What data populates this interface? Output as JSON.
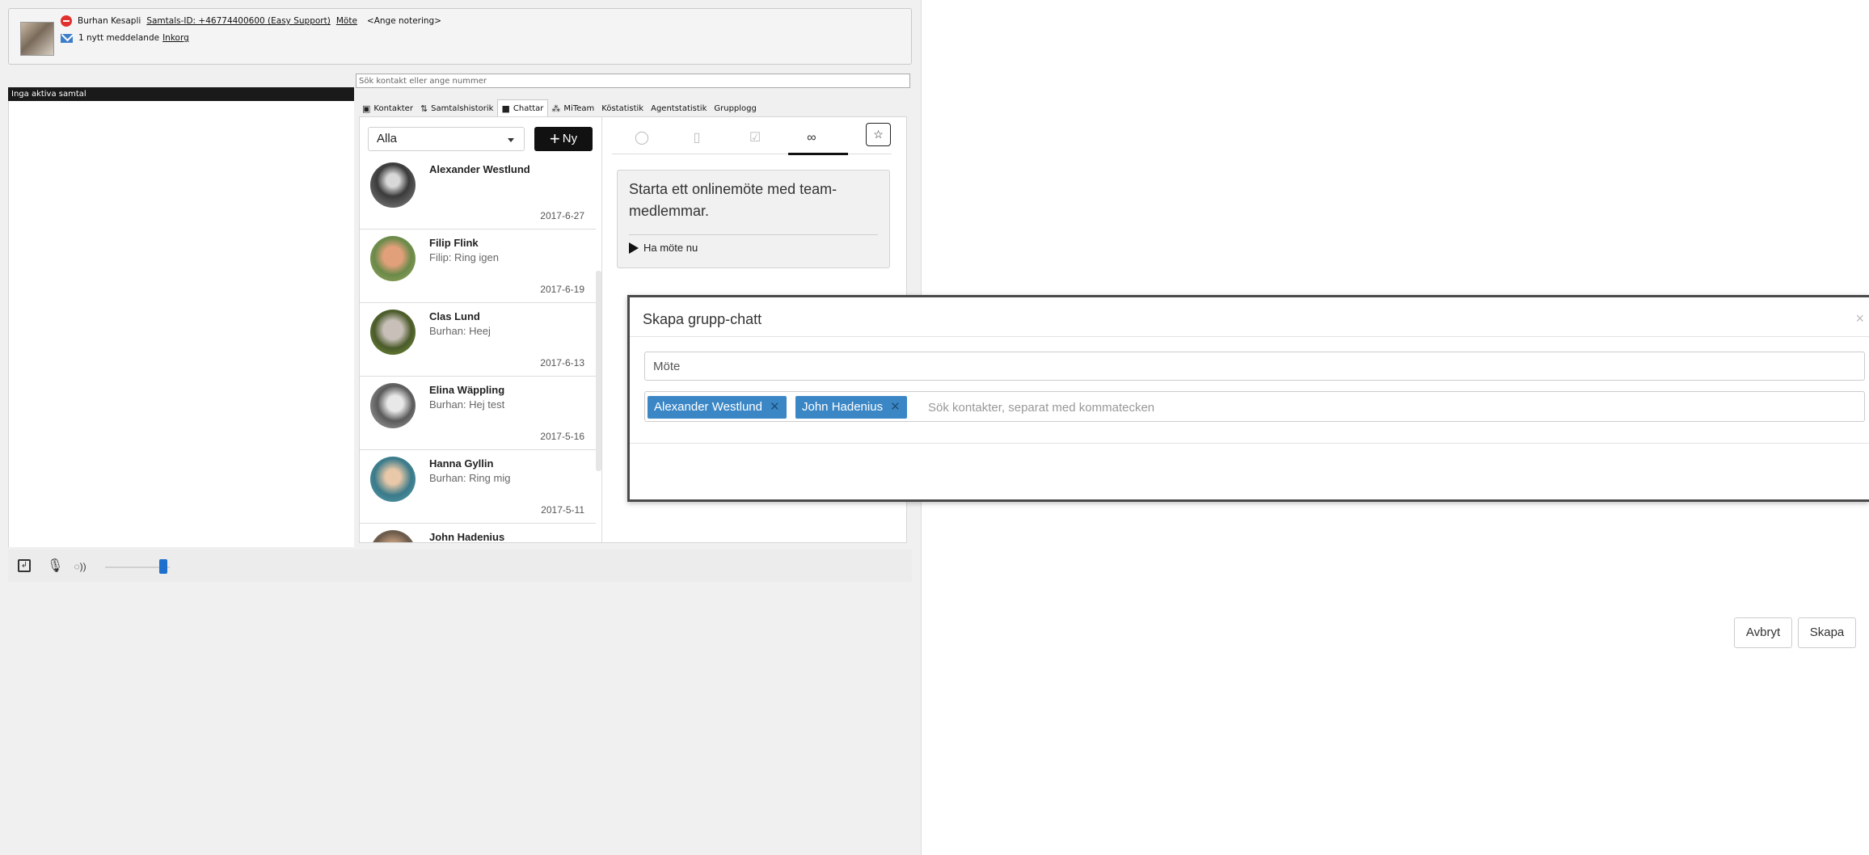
{
  "status": {
    "caller_name": "Burhan Kesapli",
    "call_id": "Samtals-ID: +46774400600 (Easy Support)",
    "meeting_link": "Möte",
    "note_placeholder": "<Ange notering>",
    "messages_text": "1 nytt meddelande",
    "inbox_link": "Inkorg"
  },
  "calls_panel": {
    "header": "Inga aktiva samtal"
  },
  "search": {
    "placeholder": "Sök kontakt eller ange nummer"
  },
  "tabs": [
    {
      "label": "Kontakter",
      "icon": "contacts-card-icon"
    },
    {
      "label": "Samtalshistorik",
      "icon": "call-history-icon"
    },
    {
      "label": "Chattar",
      "icon": "chat-bubble-icon",
      "active": true
    },
    {
      "label": "MiTeam",
      "icon": "team-icon"
    },
    {
      "label": "Köstatistik"
    },
    {
      "label": "Agentstatistik"
    },
    {
      "label": "Grupplogg"
    }
  ],
  "chat_list": {
    "filter_value": "Alla",
    "new_button_label": "Ny",
    "items": [
      {
        "name": "Alexander Westlund",
        "preview": "",
        "date": "2017-6-27"
      },
      {
        "name": "Filip Flink",
        "preview": "Filip: Ring igen",
        "date": "2017-6-19"
      },
      {
        "name": "Clas Lund",
        "preview": "Burhan: Heej",
        "date": "2017-6-13"
      },
      {
        "name": "Elina Wäppling",
        "preview": "Burhan: Hej test",
        "date": "2017-5-16"
      },
      {
        "name": "Hanna Gyllin",
        "preview": "Burhan: Ring mig",
        "date": "2017-5-11"
      },
      {
        "name": "John Hadenius",
        "preview": "",
        "date": ""
      }
    ]
  },
  "meeting_card": {
    "text": "Starta ett onlinemöte med team-medlemmar.",
    "action_label": "Ha möte nu"
  },
  "modal": {
    "title": "Skapa grupp-chatt",
    "name_value": "Möte",
    "recipients": [
      "Alexander Westlund",
      "John Hadenius"
    ],
    "recipient_placeholder": "Sök kontakter, separat med kommatecken",
    "cancel_label": "Avbryt",
    "create_label": "Skapa"
  },
  "colors": {
    "accent_blue": "#3b87c6",
    "dnd_red": "#e0302d",
    "volume_blue": "#1f6fcc"
  },
  "volume_level": 0.9
}
